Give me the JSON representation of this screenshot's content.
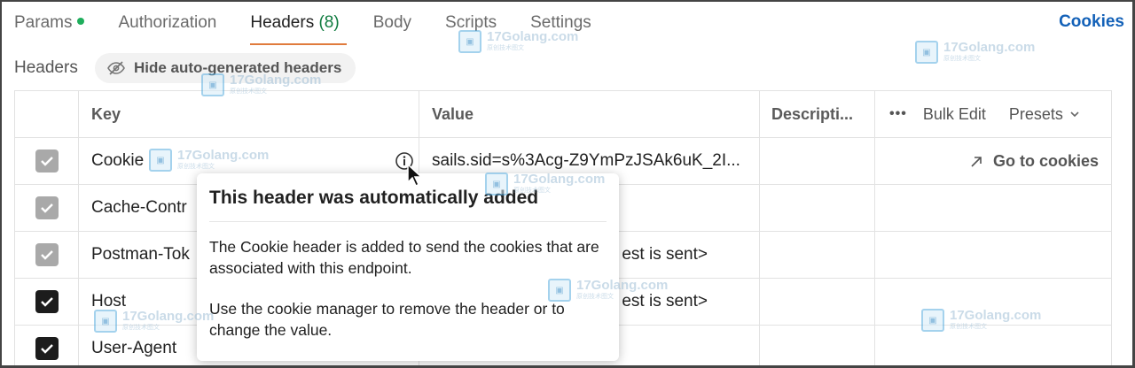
{
  "tabs": [
    {
      "label": "Params"
    },
    {
      "label": "Authorization"
    },
    {
      "label": "Headers",
      "count": "(8)"
    },
    {
      "label": "Body"
    },
    {
      "label": "Scripts"
    },
    {
      "label": "Settings"
    }
  ],
  "cookies_link": "Cookies",
  "headers_label": "Headers",
  "hide_button": "Hide auto-generated headers",
  "table": {
    "columns": {
      "key": "Key",
      "value": "Value",
      "description": "Descripti...",
      "more": "•••",
      "bulk_edit": "Bulk Edit",
      "presets": "Presets"
    },
    "rows": [
      {
        "key": "Cookie",
        "value": "sails.sid=s%3Acg-Z9YmPzJSAk6uK_2I...",
        "checked": "grey"
      },
      {
        "key": "Cache-Contr",
        "value": "",
        "checked": "grey"
      },
      {
        "key": "Postman-Tok",
        "value": "est is sent>",
        "checked": "grey"
      },
      {
        "key": "Host",
        "value": "est is sent>",
        "checked": "dark"
      },
      {
        "key": "User-Agent",
        "value": "",
        "checked": "dark"
      }
    ],
    "go_to_cookies": "Go to cookies"
  },
  "tooltip": {
    "title": "This header was automatically added",
    "paragraph1": "The Cookie header is added to send the cookies that are associated with this endpoint.",
    "paragraph2": "Use the cookie manager to remove the header or to change the value."
  },
  "watermark": {
    "text": "17Golang.com",
    "sub": "原创技术图文"
  },
  "colors": {
    "accent_orange": "#e07b3c",
    "link_blue": "#1361b8",
    "count_green": "#0f7b3f",
    "status_dot": "#1fae5c"
  }
}
